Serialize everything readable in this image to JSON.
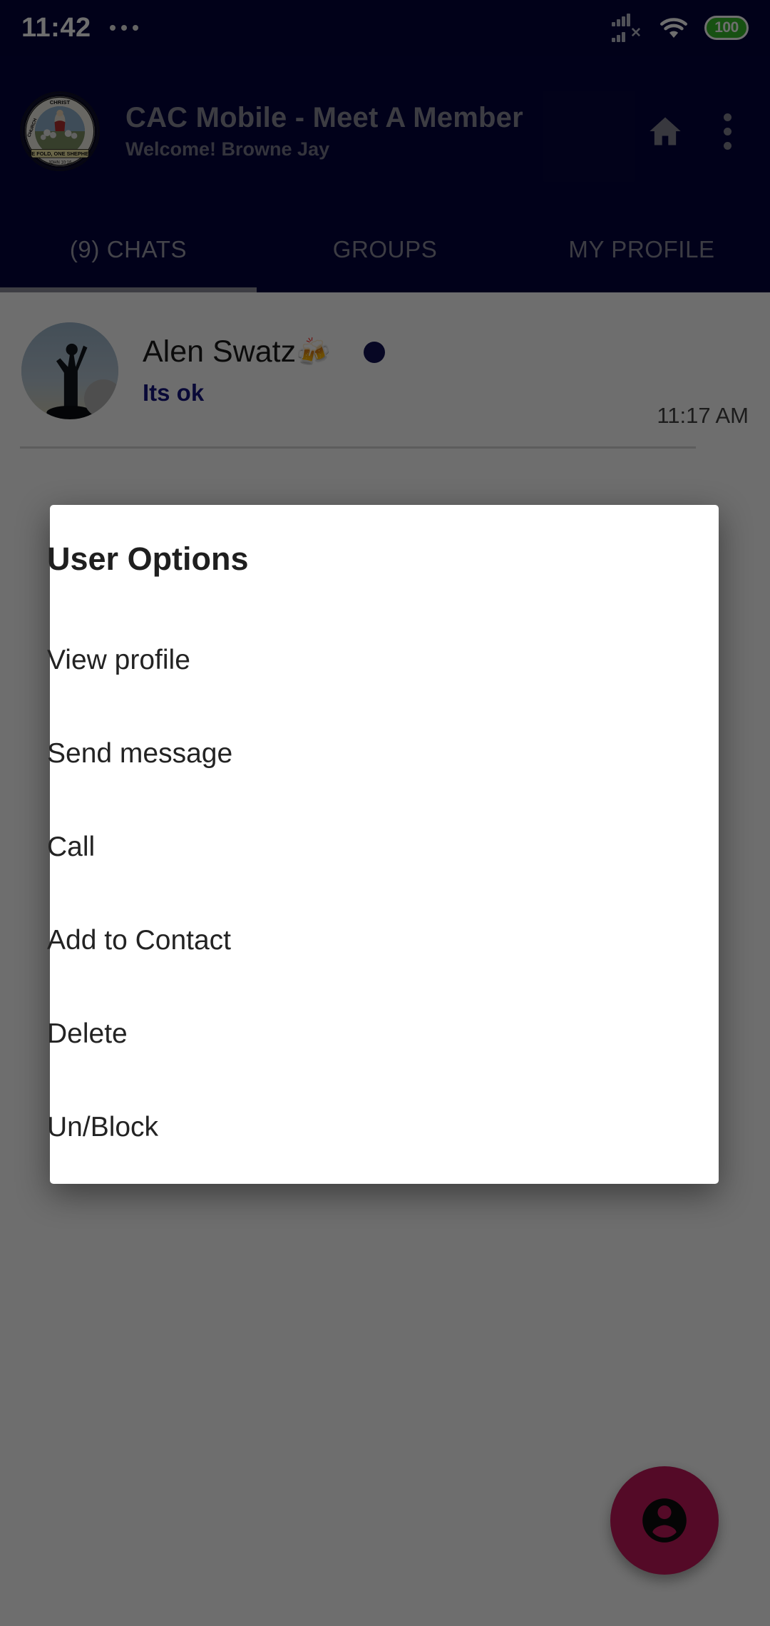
{
  "status_bar": {
    "time": "11:42",
    "battery_level": "100",
    "icons": [
      "more-dots",
      "signal-bars-no-service",
      "wifi",
      "battery"
    ]
  },
  "app_bar": {
    "logo": {
      "name": "christ-apostolic-church-seal",
      "ring_text": "CHRIST APOSTOLIC CHURCH",
      "banner_text": "ONE FOLD, ONE SHEPHERD",
      "verse": "JOHN 10:16"
    },
    "title": "CAC Mobile - Meet A Member",
    "subtitle": "Welcome! Browne Jay",
    "actions": [
      {
        "name": "home-icon",
        "label": "Home"
      },
      {
        "name": "overflow-menu-icon",
        "label": "More options"
      }
    ]
  },
  "tabs": [
    {
      "label": "(9) CHATS",
      "active": true
    },
    {
      "label": "GROUPS",
      "active": false
    },
    {
      "label": "MY PROFILE",
      "active": false
    }
  ],
  "chats": [
    {
      "name": "Alen Swatz",
      "emoji": "🍻",
      "preview": "Its ok",
      "time": "11:17 AM",
      "online": true
    }
  ],
  "fab": {
    "icon": "account-circle-icon",
    "color": "#C2185B"
  },
  "dialog": {
    "title": "User Options",
    "items": [
      "View profile",
      "Send message",
      "Call",
      "Add to Contact",
      "Delete",
      "Un/Block"
    ]
  },
  "colors": {
    "app_bar": "#04043C",
    "accent": "#C2185B",
    "preview_text": "#161680",
    "status_dot": "#111155",
    "battery": "#36BB2A"
  }
}
